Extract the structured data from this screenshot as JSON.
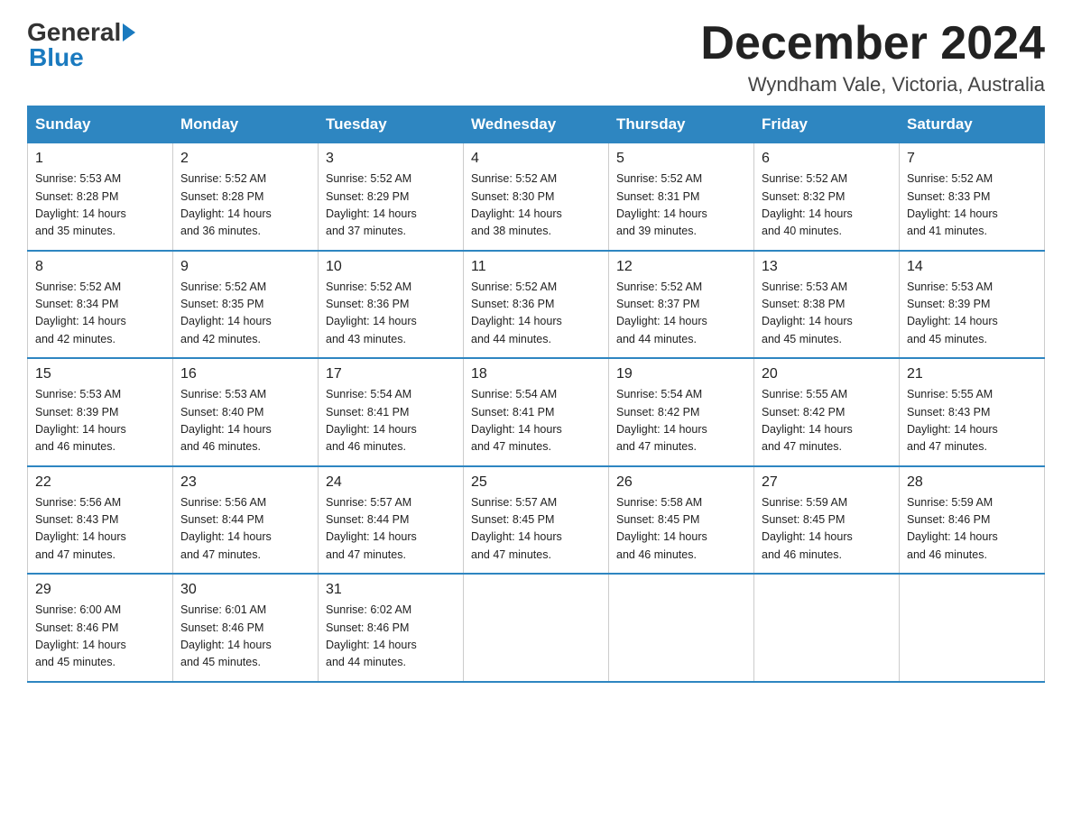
{
  "logo": {
    "text_general": "General",
    "text_blue": "Blue"
  },
  "header": {
    "title": "December 2024",
    "subtitle": "Wyndham Vale, Victoria, Australia"
  },
  "days_of_week": [
    "Sunday",
    "Monday",
    "Tuesday",
    "Wednesday",
    "Thursday",
    "Friday",
    "Saturday"
  ],
  "weeks": [
    [
      {
        "day": "1",
        "sunrise": "5:53 AM",
        "sunset": "8:28 PM",
        "daylight": "14 hours and 35 minutes."
      },
      {
        "day": "2",
        "sunrise": "5:52 AM",
        "sunset": "8:28 PM",
        "daylight": "14 hours and 36 minutes."
      },
      {
        "day": "3",
        "sunrise": "5:52 AM",
        "sunset": "8:29 PM",
        "daylight": "14 hours and 37 minutes."
      },
      {
        "day": "4",
        "sunrise": "5:52 AM",
        "sunset": "8:30 PM",
        "daylight": "14 hours and 38 minutes."
      },
      {
        "day": "5",
        "sunrise": "5:52 AM",
        "sunset": "8:31 PM",
        "daylight": "14 hours and 39 minutes."
      },
      {
        "day": "6",
        "sunrise": "5:52 AM",
        "sunset": "8:32 PM",
        "daylight": "14 hours and 40 minutes."
      },
      {
        "day": "7",
        "sunrise": "5:52 AM",
        "sunset": "8:33 PM",
        "daylight": "14 hours and 41 minutes."
      }
    ],
    [
      {
        "day": "8",
        "sunrise": "5:52 AM",
        "sunset": "8:34 PM",
        "daylight": "14 hours and 42 minutes."
      },
      {
        "day": "9",
        "sunrise": "5:52 AM",
        "sunset": "8:35 PM",
        "daylight": "14 hours and 42 minutes."
      },
      {
        "day": "10",
        "sunrise": "5:52 AM",
        "sunset": "8:36 PM",
        "daylight": "14 hours and 43 minutes."
      },
      {
        "day": "11",
        "sunrise": "5:52 AM",
        "sunset": "8:36 PM",
        "daylight": "14 hours and 44 minutes."
      },
      {
        "day": "12",
        "sunrise": "5:52 AM",
        "sunset": "8:37 PM",
        "daylight": "14 hours and 44 minutes."
      },
      {
        "day": "13",
        "sunrise": "5:53 AM",
        "sunset": "8:38 PM",
        "daylight": "14 hours and 45 minutes."
      },
      {
        "day": "14",
        "sunrise": "5:53 AM",
        "sunset": "8:39 PM",
        "daylight": "14 hours and 45 minutes."
      }
    ],
    [
      {
        "day": "15",
        "sunrise": "5:53 AM",
        "sunset": "8:39 PM",
        "daylight": "14 hours and 46 minutes."
      },
      {
        "day": "16",
        "sunrise": "5:53 AM",
        "sunset": "8:40 PM",
        "daylight": "14 hours and 46 minutes."
      },
      {
        "day": "17",
        "sunrise": "5:54 AM",
        "sunset": "8:41 PM",
        "daylight": "14 hours and 46 minutes."
      },
      {
        "day": "18",
        "sunrise": "5:54 AM",
        "sunset": "8:41 PM",
        "daylight": "14 hours and 47 minutes."
      },
      {
        "day": "19",
        "sunrise": "5:54 AM",
        "sunset": "8:42 PM",
        "daylight": "14 hours and 47 minutes."
      },
      {
        "day": "20",
        "sunrise": "5:55 AM",
        "sunset": "8:42 PM",
        "daylight": "14 hours and 47 minutes."
      },
      {
        "day": "21",
        "sunrise": "5:55 AM",
        "sunset": "8:43 PM",
        "daylight": "14 hours and 47 minutes."
      }
    ],
    [
      {
        "day": "22",
        "sunrise": "5:56 AM",
        "sunset": "8:43 PM",
        "daylight": "14 hours and 47 minutes."
      },
      {
        "day": "23",
        "sunrise": "5:56 AM",
        "sunset": "8:44 PM",
        "daylight": "14 hours and 47 minutes."
      },
      {
        "day": "24",
        "sunrise": "5:57 AM",
        "sunset": "8:44 PM",
        "daylight": "14 hours and 47 minutes."
      },
      {
        "day": "25",
        "sunrise": "5:57 AM",
        "sunset": "8:45 PM",
        "daylight": "14 hours and 47 minutes."
      },
      {
        "day": "26",
        "sunrise": "5:58 AM",
        "sunset": "8:45 PM",
        "daylight": "14 hours and 46 minutes."
      },
      {
        "day": "27",
        "sunrise": "5:59 AM",
        "sunset": "8:45 PM",
        "daylight": "14 hours and 46 minutes."
      },
      {
        "day": "28",
        "sunrise": "5:59 AM",
        "sunset": "8:46 PM",
        "daylight": "14 hours and 46 minutes."
      }
    ],
    [
      {
        "day": "29",
        "sunrise": "6:00 AM",
        "sunset": "8:46 PM",
        "daylight": "14 hours and 45 minutes."
      },
      {
        "day": "30",
        "sunrise": "6:01 AM",
        "sunset": "8:46 PM",
        "daylight": "14 hours and 45 minutes."
      },
      {
        "day": "31",
        "sunrise": "6:02 AM",
        "sunset": "8:46 PM",
        "daylight": "14 hours and 44 minutes."
      },
      null,
      null,
      null,
      null
    ]
  ],
  "labels": {
    "sunrise": "Sunrise:",
    "sunset": "Sunset:",
    "daylight": "Daylight:"
  }
}
